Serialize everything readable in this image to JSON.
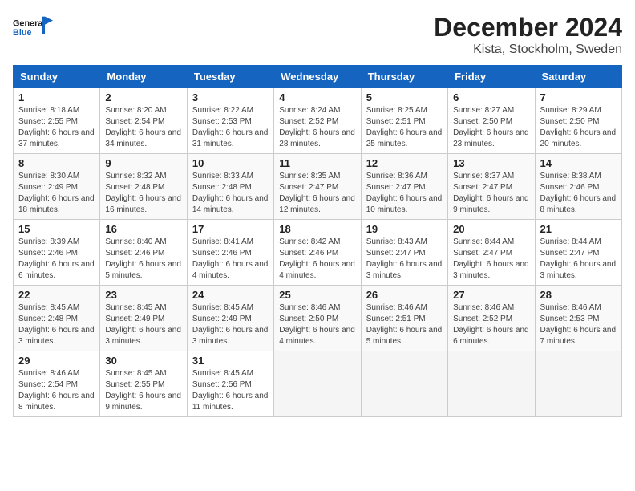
{
  "header": {
    "logo_general": "General",
    "logo_blue": "Blue",
    "title": "December 2024",
    "subtitle": "Kista, Stockholm, Sweden"
  },
  "days_of_week": [
    "Sunday",
    "Monday",
    "Tuesday",
    "Wednesday",
    "Thursday",
    "Friday",
    "Saturday"
  ],
  "weeks": [
    [
      {
        "day": 1,
        "sunrise": "8:18 AM",
        "sunset": "2:55 PM",
        "daylight": "6 hours and 37 minutes."
      },
      {
        "day": 2,
        "sunrise": "8:20 AM",
        "sunset": "2:54 PM",
        "daylight": "6 hours and 34 minutes."
      },
      {
        "day": 3,
        "sunrise": "8:22 AM",
        "sunset": "2:53 PM",
        "daylight": "6 hours and 31 minutes."
      },
      {
        "day": 4,
        "sunrise": "8:24 AM",
        "sunset": "2:52 PM",
        "daylight": "6 hours and 28 minutes."
      },
      {
        "day": 5,
        "sunrise": "8:25 AM",
        "sunset": "2:51 PM",
        "daylight": "6 hours and 25 minutes."
      },
      {
        "day": 6,
        "sunrise": "8:27 AM",
        "sunset": "2:50 PM",
        "daylight": "6 hours and 23 minutes."
      },
      {
        "day": 7,
        "sunrise": "8:29 AM",
        "sunset": "2:50 PM",
        "daylight": "6 hours and 20 minutes."
      }
    ],
    [
      {
        "day": 8,
        "sunrise": "8:30 AM",
        "sunset": "2:49 PM",
        "daylight": "6 hours and 18 minutes."
      },
      {
        "day": 9,
        "sunrise": "8:32 AM",
        "sunset": "2:48 PM",
        "daylight": "6 hours and 16 minutes."
      },
      {
        "day": 10,
        "sunrise": "8:33 AM",
        "sunset": "2:48 PM",
        "daylight": "6 hours and 14 minutes."
      },
      {
        "day": 11,
        "sunrise": "8:35 AM",
        "sunset": "2:47 PM",
        "daylight": "6 hours and 12 minutes."
      },
      {
        "day": 12,
        "sunrise": "8:36 AM",
        "sunset": "2:47 PM",
        "daylight": "6 hours and 10 minutes."
      },
      {
        "day": 13,
        "sunrise": "8:37 AM",
        "sunset": "2:47 PM",
        "daylight": "6 hours and 9 minutes."
      },
      {
        "day": 14,
        "sunrise": "8:38 AM",
        "sunset": "2:46 PM",
        "daylight": "6 hours and 8 minutes."
      }
    ],
    [
      {
        "day": 15,
        "sunrise": "8:39 AM",
        "sunset": "2:46 PM",
        "daylight": "6 hours and 6 minutes."
      },
      {
        "day": 16,
        "sunrise": "8:40 AM",
        "sunset": "2:46 PM",
        "daylight": "6 hours and 5 minutes."
      },
      {
        "day": 17,
        "sunrise": "8:41 AM",
        "sunset": "2:46 PM",
        "daylight": "6 hours and 4 minutes."
      },
      {
        "day": 18,
        "sunrise": "8:42 AM",
        "sunset": "2:46 PM",
        "daylight": "6 hours and 4 minutes."
      },
      {
        "day": 19,
        "sunrise": "8:43 AM",
        "sunset": "2:47 PM",
        "daylight": "6 hours and 3 minutes."
      },
      {
        "day": 20,
        "sunrise": "8:44 AM",
        "sunset": "2:47 PM",
        "daylight": "6 hours and 3 minutes."
      },
      {
        "day": 21,
        "sunrise": "8:44 AM",
        "sunset": "2:47 PM",
        "daylight": "6 hours and 3 minutes."
      }
    ],
    [
      {
        "day": 22,
        "sunrise": "8:45 AM",
        "sunset": "2:48 PM",
        "daylight": "6 hours and 3 minutes."
      },
      {
        "day": 23,
        "sunrise": "8:45 AM",
        "sunset": "2:49 PM",
        "daylight": "6 hours and 3 minutes."
      },
      {
        "day": 24,
        "sunrise": "8:45 AM",
        "sunset": "2:49 PM",
        "daylight": "6 hours and 3 minutes."
      },
      {
        "day": 25,
        "sunrise": "8:46 AM",
        "sunset": "2:50 PM",
        "daylight": "6 hours and 4 minutes."
      },
      {
        "day": 26,
        "sunrise": "8:46 AM",
        "sunset": "2:51 PM",
        "daylight": "6 hours and 5 minutes."
      },
      {
        "day": 27,
        "sunrise": "8:46 AM",
        "sunset": "2:52 PM",
        "daylight": "6 hours and 6 minutes."
      },
      {
        "day": 28,
        "sunrise": "8:46 AM",
        "sunset": "2:53 PM",
        "daylight": "6 hours and 7 minutes."
      }
    ],
    [
      {
        "day": 29,
        "sunrise": "8:46 AM",
        "sunset": "2:54 PM",
        "daylight": "6 hours and 8 minutes."
      },
      {
        "day": 30,
        "sunrise": "8:45 AM",
        "sunset": "2:55 PM",
        "daylight": "6 hours and 9 minutes."
      },
      {
        "day": 31,
        "sunrise": "8:45 AM",
        "sunset": "2:56 PM",
        "daylight": "6 hours and 11 minutes."
      },
      null,
      null,
      null,
      null
    ]
  ]
}
